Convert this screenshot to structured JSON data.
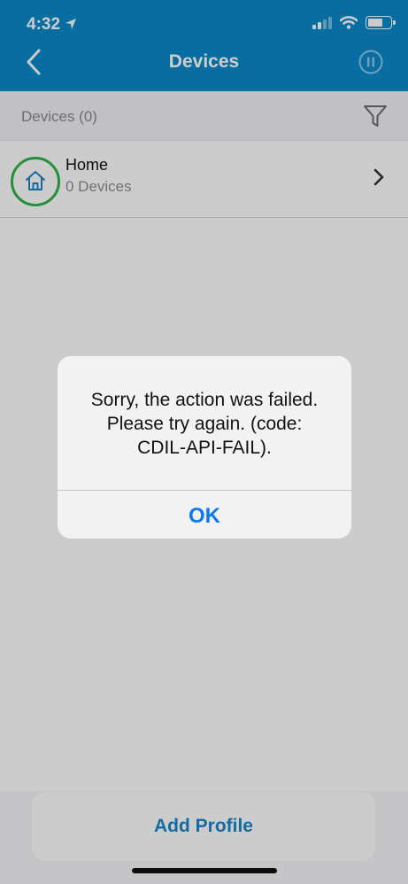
{
  "status_bar": {
    "time": "4:32"
  },
  "nav": {
    "title": "Devices",
    "back_icon": "chevron-left-icon",
    "right_icon": "pause-circle-icon"
  },
  "section": {
    "title": "Devices (0)",
    "filter_icon": "filter-icon"
  },
  "profiles": [
    {
      "name": "Home",
      "subtitle": "0 Devices",
      "icon": "home-icon"
    }
  ],
  "footer": {
    "add_profile_label": "Add Profile"
  },
  "alert": {
    "message_lines": [
      "Sorry, the action was failed.",
      "Please try again. (code:",
      "CDIL-API-FAIL)."
    ],
    "ok_label": "OK"
  },
  "colors": {
    "brand_blue": "#0a8acb",
    "accent_green": "#2fb34a",
    "link_blue": "#0a7af0"
  }
}
